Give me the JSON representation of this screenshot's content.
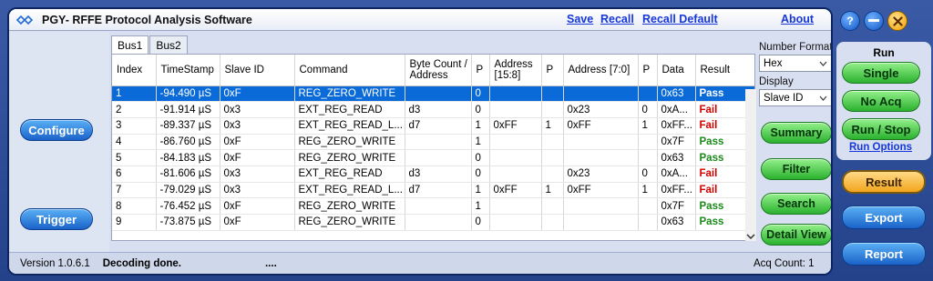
{
  "app": {
    "title": "PGY- RFFE Protocol Analysis Software",
    "links": {
      "save": "Save",
      "recall": "Recall",
      "recall_default": "Recall Default",
      "about": "About"
    }
  },
  "left": {
    "configure": "Configure",
    "trigger": "Trigger"
  },
  "tabs": [
    "Bus1",
    "Bus2"
  ],
  "table": {
    "headers": {
      "index": "Index",
      "timestamp": "TimeStamp",
      "slave_id": "Slave ID",
      "command": "Command",
      "byte_count_l1": "Byte Count /",
      "byte_count_l2": "Address",
      "p1": "P",
      "addr_hi_l1": "Address",
      "addr_hi_l2": "[15:8]",
      "p2": "P",
      "addr_lo": "Address [7:0]",
      "p3": "P",
      "data": "Data",
      "result": "Result"
    },
    "rows": [
      {
        "index": "1",
        "ts": "-94.490 µS",
        "slave": "0xF",
        "cmd": "REG_ZERO_WRITE",
        "bc": "",
        "p1": "0",
        "ahi": "",
        "p2": "",
        "alo": "",
        "p3": "",
        "data": "0x63",
        "result": "Pass"
      },
      {
        "index": "2",
        "ts": "-91.914 µS",
        "slave": "0x3",
        "cmd": "EXT_REG_READ",
        "bc": "d3",
        "p1": "0",
        "ahi": "",
        "p2": "",
        "alo": "0x23",
        "p3": "0",
        "data": "0xA...",
        "result": "Fail"
      },
      {
        "index": "3",
        "ts": "-89.337 µS",
        "slave": "0x3",
        "cmd": "EXT_REG_READ_L...",
        "bc": "d7",
        "p1": "1",
        "ahi": "0xFF",
        "p2": "1",
        "alo": "0xFF",
        "p3": "1",
        "data": "0xFF...",
        "result": "Fail"
      },
      {
        "index": "4",
        "ts": "-86.760 µS",
        "slave": "0xF",
        "cmd": "REG_ZERO_WRITE",
        "bc": "",
        "p1": "1",
        "ahi": "",
        "p2": "",
        "alo": "",
        "p3": "",
        "data": "0x7F",
        "result": "Pass"
      },
      {
        "index": "5",
        "ts": "-84.183 µS",
        "slave": "0xF",
        "cmd": "REG_ZERO_WRITE",
        "bc": "",
        "p1": "0",
        "ahi": "",
        "p2": "",
        "alo": "",
        "p3": "",
        "data": "0x63",
        "result": "Pass"
      },
      {
        "index": "6",
        "ts": "-81.606 µS",
        "slave": "0x3",
        "cmd": "EXT_REG_READ",
        "bc": "d3",
        "p1": "0",
        "ahi": "",
        "p2": "",
        "alo": "0x23",
        "p3": "0",
        "data": "0xA...",
        "result": "Fail"
      },
      {
        "index": "7",
        "ts": "-79.029 µS",
        "slave": "0x3",
        "cmd": "EXT_REG_READ_L...",
        "bc": "d7",
        "p1": "1",
        "ahi": "0xFF",
        "p2": "1",
        "alo": "0xFF",
        "p3": "1",
        "data": "0xFF...",
        "result": "Fail"
      },
      {
        "index": "8",
        "ts": "-76.452 µS",
        "slave": "0xF",
        "cmd": "REG_ZERO_WRITE",
        "bc": "",
        "p1": "1",
        "ahi": "",
        "p2": "",
        "alo": "",
        "p3": "",
        "data": "0x7F",
        "result": "Pass"
      },
      {
        "index": "9",
        "ts": "-73.875 µS",
        "slave": "0xF",
        "cmd": "REG_ZERO_WRITE",
        "bc": "",
        "p1": "0",
        "ahi": "",
        "p2": "",
        "alo": "",
        "p3": "",
        "data": "0x63",
        "result": "Pass"
      }
    ]
  },
  "right": {
    "number_format_label": "Number Format",
    "number_format_value": "Hex",
    "display_label": "Display",
    "display_value": "Slave ID",
    "buttons": {
      "summary": "Summary",
      "filter": "Filter",
      "search": "Search",
      "detail_view": "Detail View"
    }
  },
  "status": {
    "version": "Version 1.0.6.1",
    "message": "Decoding done.",
    "dots": "....",
    "acq_count": "Acq Count: 1"
  },
  "side": {
    "help": "?",
    "run_title": "Run",
    "single": "Single",
    "no_acq": "No Acq",
    "run_stop": "Run / Stop",
    "run_options": "Run Options",
    "result": "Result",
    "export": "Export",
    "report": "Report"
  },
  "colors": {
    "selected_row": "#0a6ad8",
    "pass": "#1a8a18",
    "fail": "#d40000"
  }
}
